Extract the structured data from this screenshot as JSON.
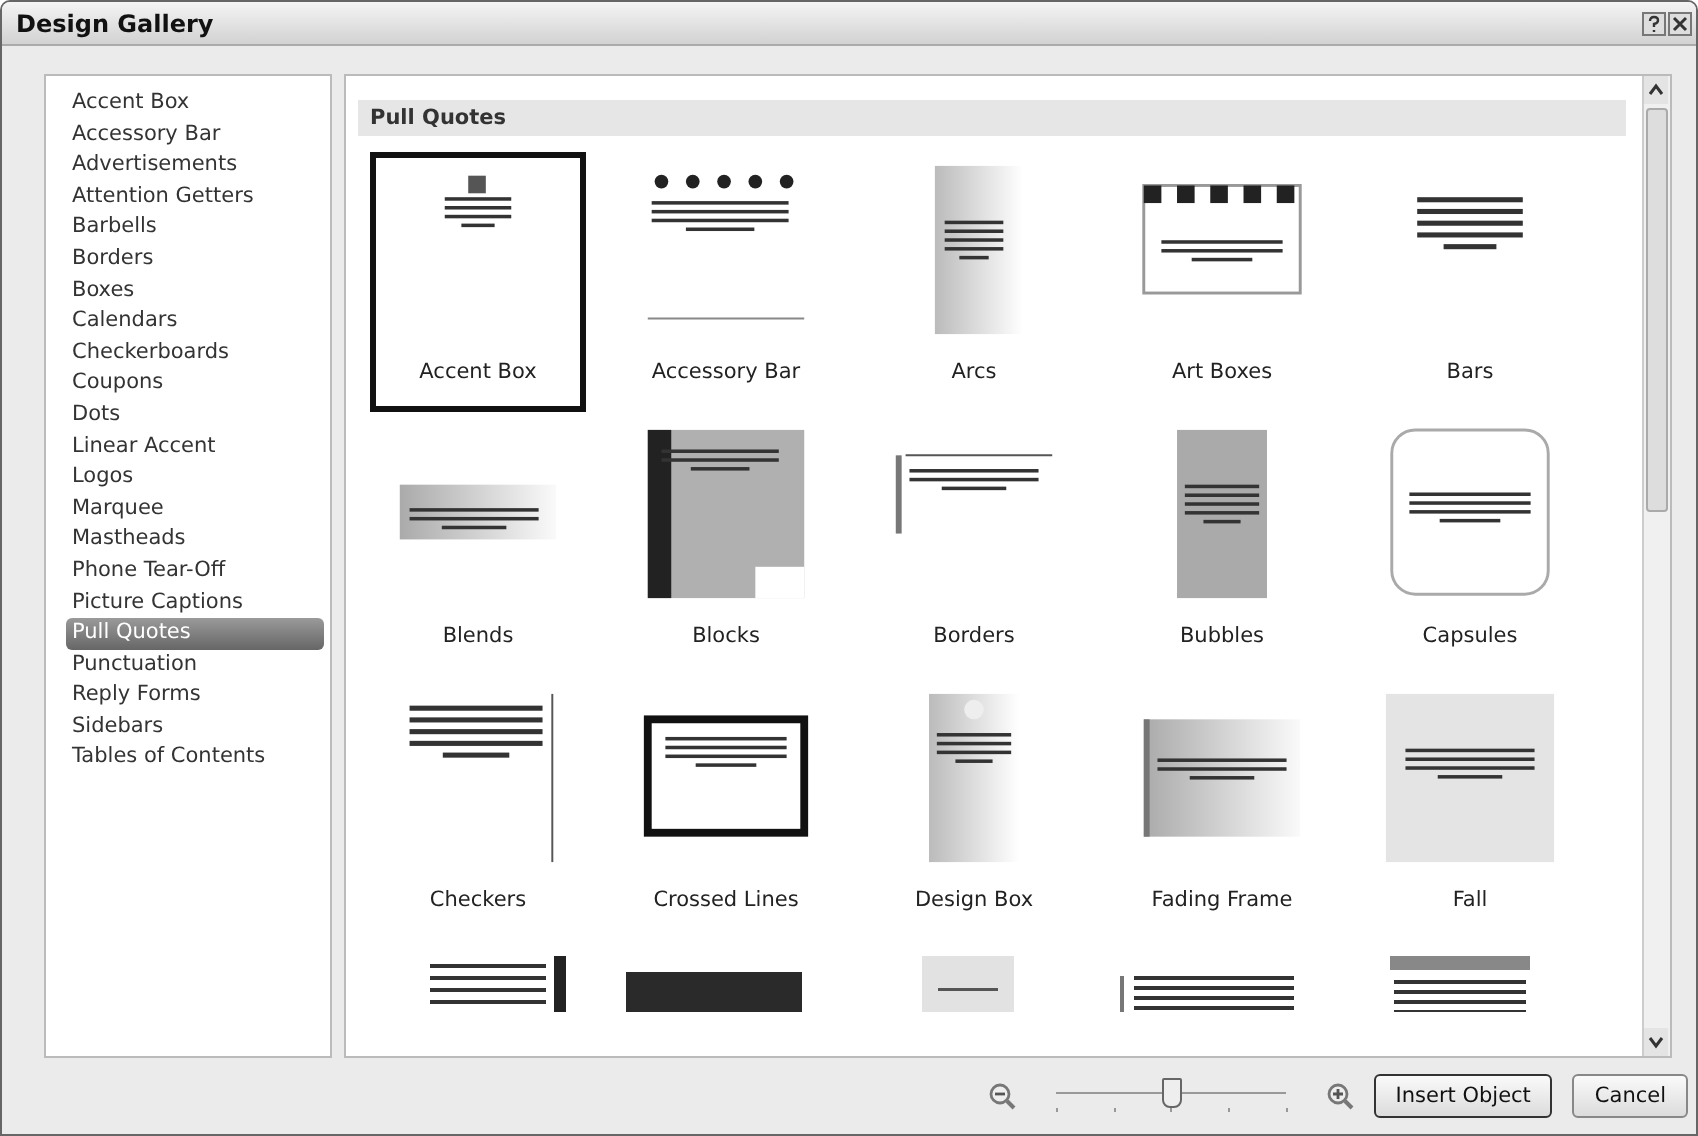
{
  "window": {
    "title": "Design Gallery"
  },
  "categories": [
    {
      "label": "Accent Box",
      "selected": false
    },
    {
      "label": "Accessory Bar",
      "selected": false
    },
    {
      "label": "Advertisements",
      "selected": false
    },
    {
      "label": "Attention Getters",
      "selected": false
    },
    {
      "label": "Barbells",
      "selected": false
    },
    {
      "label": "Borders",
      "selected": false
    },
    {
      "label": "Boxes",
      "selected": false
    },
    {
      "label": "Calendars",
      "selected": false
    },
    {
      "label": "Checkerboards",
      "selected": false
    },
    {
      "label": "Coupons",
      "selected": false
    },
    {
      "label": "Dots",
      "selected": false
    },
    {
      "label": "Linear Accent",
      "selected": false
    },
    {
      "label": "Logos",
      "selected": false
    },
    {
      "label": "Marquee",
      "selected": false
    },
    {
      "label": "Mastheads",
      "selected": false
    },
    {
      "label": "Phone Tear-Off",
      "selected": false
    },
    {
      "label": "Picture Captions",
      "selected": false
    },
    {
      "label": "Pull Quotes",
      "selected": true
    },
    {
      "label": "Punctuation",
      "selected": false
    },
    {
      "label": "Reply Forms",
      "selected": false
    },
    {
      "label": "Sidebars",
      "selected": false
    },
    {
      "label": "Tables of Contents",
      "selected": false
    }
  ],
  "gallery": {
    "heading": "Pull Quotes",
    "items": [
      {
        "label": "Accent Box",
        "selected": true
      },
      {
        "label": "Accessory Bar",
        "selected": false
      },
      {
        "label": "Arcs",
        "selected": false
      },
      {
        "label": "Art Boxes",
        "selected": false
      },
      {
        "label": "Bars",
        "selected": false
      },
      {
        "label": "Blends",
        "selected": false
      },
      {
        "label": "Blocks",
        "selected": false
      },
      {
        "label": "Borders",
        "selected": false
      },
      {
        "label": "Bubbles",
        "selected": false
      },
      {
        "label": "Capsules",
        "selected": false
      },
      {
        "label": "Checkers",
        "selected": false
      },
      {
        "label": "Crossed Lines",
        "selected": false
      },
      {
        "label": "Design Box",
        "selected": false
      },
      {
        "label": "Fading Frame",
        "selected": false
      },
      {
        "label": "Fall",
        "selected": false
      }
    ]
  },
  "zoom": {
    "level": 0.5
  },
  "buttons": [
    {
      "label": "Insert Object",
      "kind": "default"
    },
    {
      "label": "Cancel",
      "kind": "normal"
    }
  ]
}
